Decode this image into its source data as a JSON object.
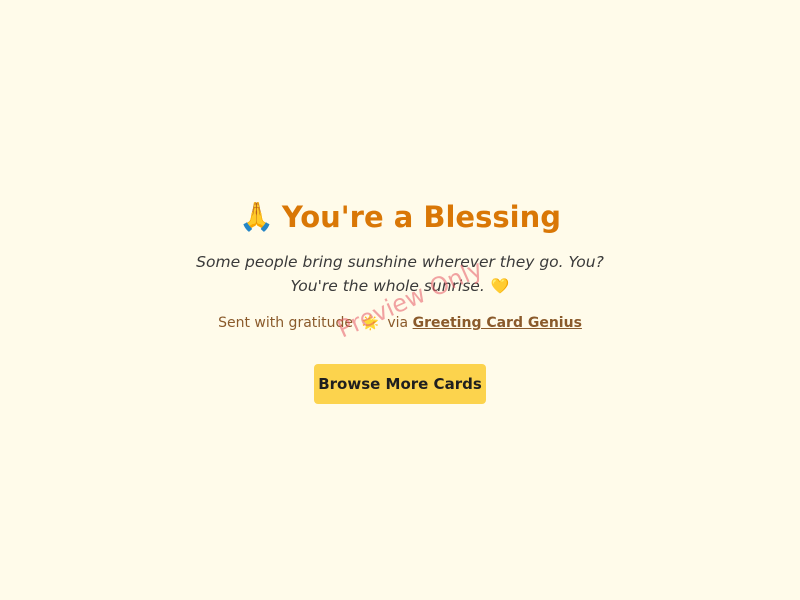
{
  "card": {
    "title_icon": "🙏",
    "title": "You're a Blessing",
    "message": "Some people bring sunshine wherever they go. You? You're the whole sunrise.",
    "message_icon": "💛",
    "footer_prefix": "Sent with gratitude",
    "footer_icon": "🌟",
    "footer_via": "via",
    "footer_link": "Greeting Card Genius",
    "button_label": "Browse More Cards"
  },
  "watermark": {
    "text": "Preview Only"
  },
  "colors": {
    "background": "#fffbea",
    "title": "#d97706",
    "button": "#fcd34d",
    "footer": "#8a5a2b"
  }
}
